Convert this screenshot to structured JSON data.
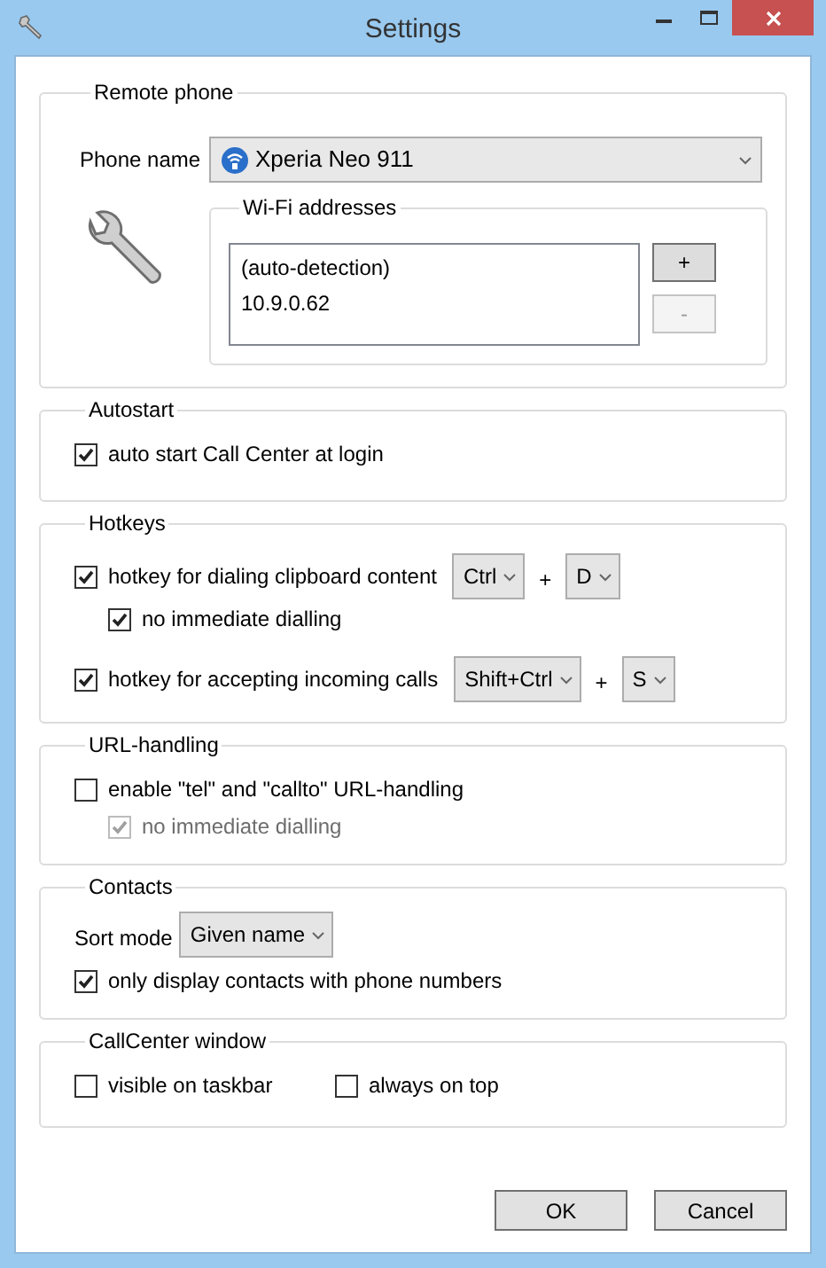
{
  "window": {
    "title": "Settings"
  },
  "remote_phone": {
    "title": "Remote phone",
    "phone_label": "Phone name",
    "phone_value": "Xperia Neo 911",
    "wifi": {
      "title": "Wi-Fi addresses",
      "addresses": [
        "(auto-detection)",
        "10.9.0.62"
      ],
      "add_button": {
        "label": "+",
        "disabled": false
      },
      "remove_button": {
        "label": "-",
        "disabled": true
      }
    }
  },
  "sections": [
    {
      "title": "Autostart",
      "items": [
        {
          "kind": "checkbox",
          "label": "auto start Call Center at login",
          "checked": true,
          "disabled": false
        }
      ]
    },
    {
      "title": "Hotkeys",
      "items": [
        {
          "kind": "hotkey",
          "label": "hotkey for dialing clipboard content",
          "checked": true,
          "disabled": false,
          "modifier": "Ctrl",
          "plus": "+",
          "key": "D",
          "children": [
            {
              "kind": "checkbox",
              "label": "no immediate dialling",
              "checked": true,
              "disabled": false
            }
          ]
        },
        {
          "kind": "hotkey",
          "label": "hotkey for accepting incoming calls",
          "checked": true,
          "disabled": false,
          "modifier": "Shift+Ctrl",
          "plus": "+",
          "key": "S"
        }
      ]
    },
    {
      "title": "URL-handling",
      "items": [
        {
          "kind": "checkbox",
          "label": "enable \"tel\" and \"callto\" URL-handling",
          "checked": false,
          "disabled": false,
          "children": [
            {
              "kind": "checkbox",
              "label": "no immediate dialling",
              "checked": true,
              "disabled": true
            }
          ]
        }
      ]
    },
    {
      "title": "Contacts",
      "items": [
        {
          "kind": "select",
          "label": "Sort mode",
          "value": "Given name"
        },
        {
          "kind": "checkbox",
          "label": "only display contacts with phone numbers",
          "checked": true,
          "disabled": false
        }
      ]
    },
    {
      "title": "CallCenter window",
      "items": [
        {
          "kind": "checkbox_pair",
          "options": [
            {
              "label": "visible on taskbar",
              "checked": false,
              "disabled": false
            },
            {
              "label": "always on top",
              "checked": false,
              "disabled": false
            }
          ]
        }
      ]
    }
  ],
  "buttons": [
    {
      "label": "OK"
    },
    {
      "label": "Cancel"
    }
  ]
}
